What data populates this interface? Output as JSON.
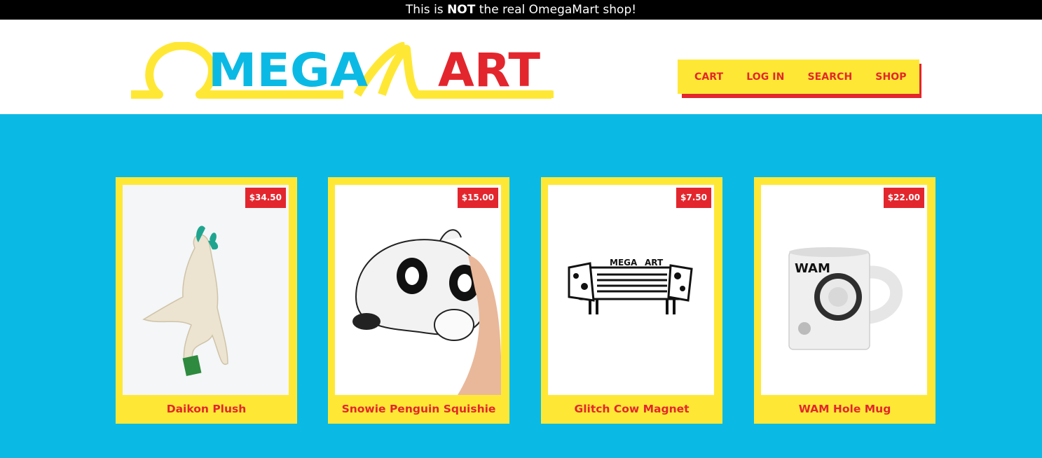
{
  "banner": {
    "prefix": "This is ",
    "emphasis": "NOT",
    "suffix": " the real OmegaMart shop!"
  },
  "brand": {
    "logo_mega": "MEGA",
    "logo_art": "ART"
  },
  "nav": {
    "cart": "Cart",
    "login": "Log in",
    "search": "Search",
    "shop": "Shop"
  },
  "products": [
    {
      "name": "Daikon Plush",
      "price": "$34.50"
    },
    {
      "name": "Snowie Penguin Squishie",
      "price": "$15.00"
    },
    {
      "name": "Glitch Cow Magnet",
      "price": "$7.50"
    },
    {
      "name": "WAM Hole Mug",
      "price": "$22.00"
    }
  ],
  "magnet_logo": {
    "mega": "MEGA",
    "art": "ART"
  },
  "mug_logo": "WAM",
  "colors": {
    "yellow": "#ffe835",
    "red": "#e3262d",
    "blue": "#0bbae4",
    "black": "#000000"
  }
}
